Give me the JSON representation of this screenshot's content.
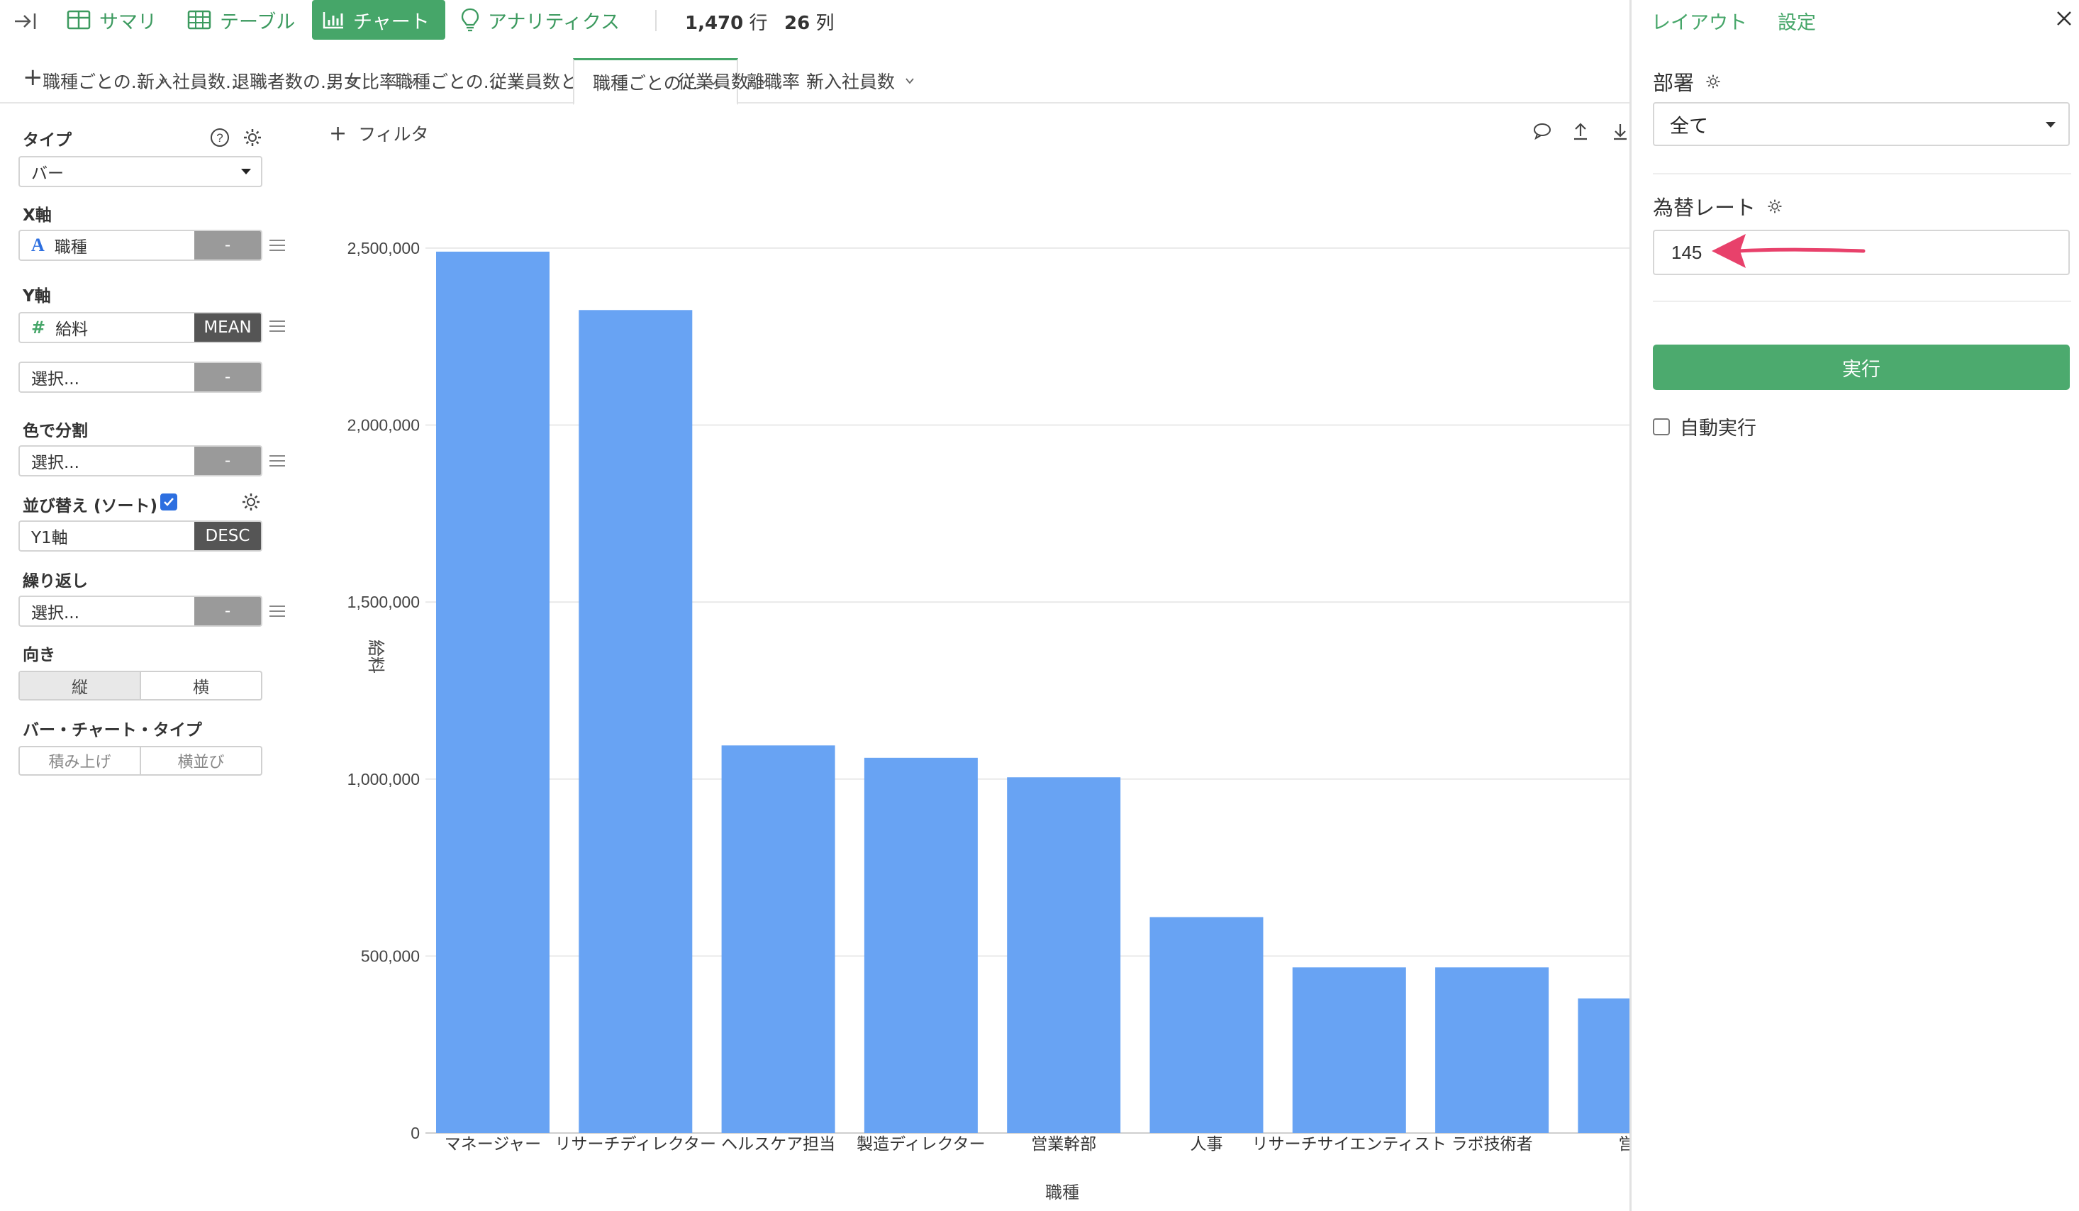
{
  "toolbar": {
    "summary_label": "サマリ",
    "table_label": "テーブル",
    "chart_label": "チャート",
    "analytics_label": "アナリティクス",
    "rows_count": "1,470",
    "rows_unit": "行",
    "cols_count": "26",
    "cols_unit": "列"
  },
  "tabs": [
    {
      "label": "職種ごとの..."
    },
    {
      "label": "新入社員数..."
    },
    {
      "label": "退職者数の..."
    },
    {
      "label": "男女比率"
    },
    {
      "label": "職種ごとの..."
    },
    {
      "label": "従業員数と..."
    },
    {
      "label": "職種ごとの...",
      "active": true
    },
    {
      "label": "従業員数"
    },
    {
      "label": "離職率"
    },
    {
      "label": "新入社員数"
    }
  ],
  "config": {
    "type_label": "タイプ",
    "type_value": "バー",
    "x_axis_label": "X軸",
    "x_axis_field": "職種",
    "x_axis_field_type_icon": "A",
    "x_axis_agg": "-",
    "y_axis_label": "Y軸",
    "y_axis_field": "給料",
    "y_axis_field_type_icon": "#",
    "y_axis_agg": "MEAN",
    "y2_placeholder": "選択...",
    "y2_agg": "-",
    "color_label": "色で分割",
    "color_placeholder": "選択...",
    "color_agg": "-",
    "sort_label": "並び替え (ソート)",
    "sort_checked": true,
    "sort_field": "Y1軸",
    "sort_order": "DESC",
    "repeat_label": "繰り返し",
    "repeat_placeholder": "選択...",
    "repeat_agg": "-",
    "orientation_label": "向き",
    "orientation_vertical": "縦",
    "orientation_horizontal": "横",
    "bar_type_label": "バー・チャート・タイプ",
    "bar_type_stacked": "積み上げ",
    "bar_type_grouped": "横並び"
  },
  "chart_toolbar": {
    "filter_label": "フィルタ"
  },
  "chart_data": {
    "type": "bar",
    "categories": [
      "マネージャー",
      "リサーチディレクター",
      "ヘルスケア担当",
      "製造ディレクター",
      "営業幹部",
      "人事",
      "リサーチサイエンティスト",
      "ラボ技術者",
      "営業"
    ],
    "values": [
      2490000,
      2325000,
      1095000,
      1060000,
      1005000,
      610000,
      468000,
      468000,
      380000
    ],
    "xlabel": "職種",
    "ylabel": "給料",
    "ylim": [
      0,
      2600000
    ],
    "yticks": [
      "0",
      "500,000",
      "1,000,000",
      "1,500,000",
      "2,000,000",
      "2,500,000"
    ],
    "ytick_values": [
      0,
      500000,
      1000000,
      1500000,
      2000000,
      2500000
    ],
    "bar_color": "#68a3f3",
    "grid": true
  },
  "right_panel": {
    "tab_layout": "レイアウト",
    "tab_settings": "設定",
    "department_label": "部署",
    "department_value": "全て",
    "exchange_rate_label": "為替レート",
    "exchange_rate_value": "145",
    "run_label": "実行",
    "auto_run_label": "自動実行",
    "auto_run_checked": false
  },
  "colors": {
    "accent": "#46a669",
    "bar": "#68a3f3",
    "annotation_arrow": "#e8416b"
  }
}
